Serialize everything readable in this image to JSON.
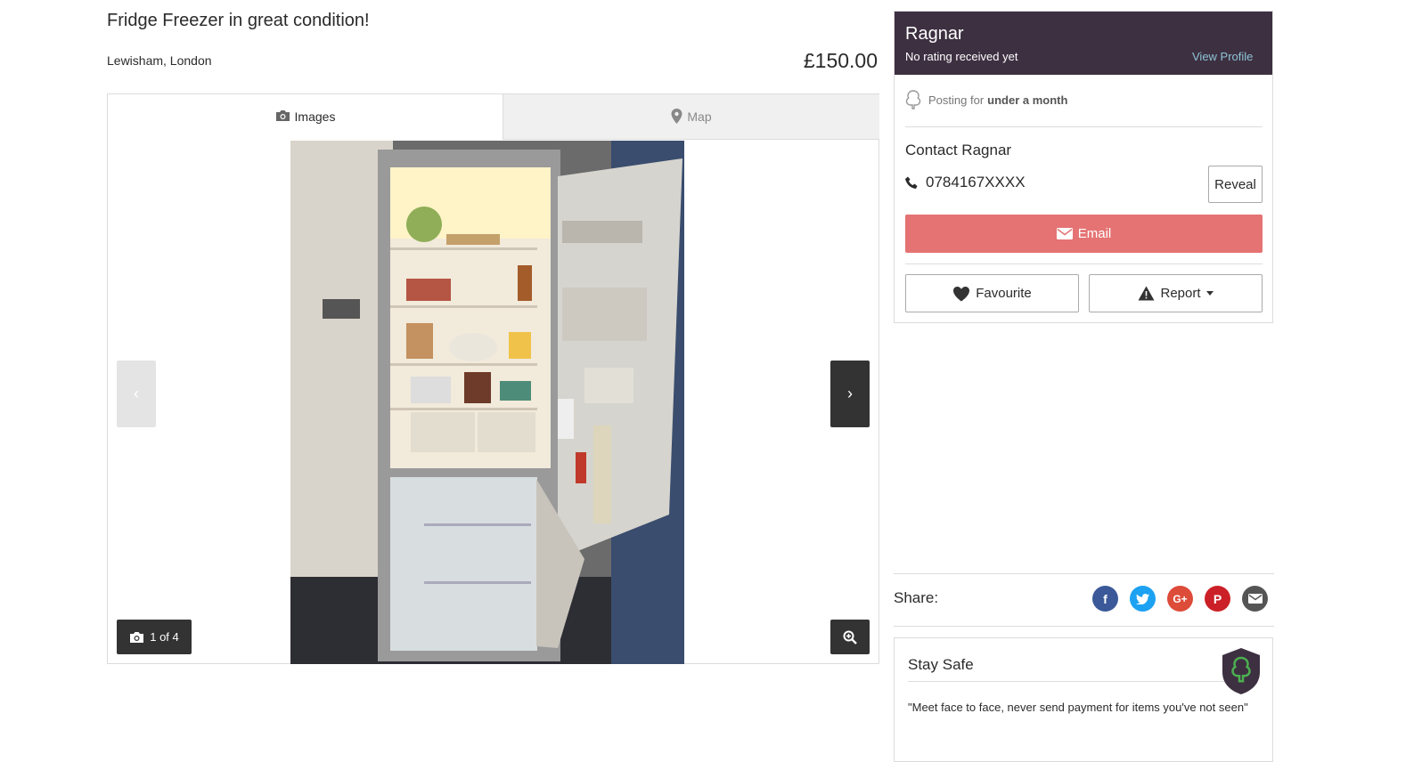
{
  "listing": {
    "title": "Fridge Freezer in great condition!",
    "location": "Lewisham, London",
    "price": "£150.00"
  },
  "gallery": {
    "tabs": [
      {
        "label": "Images",
        "icon": "camera-icon",
        "active": true
      },
      {
        "label": "Map",
        "icon": "map-pin-icon",
        "active": false
      }
    ],
    "prev_label": "‹",
    "next_label": "›",
    "counter": "1 of 4"
  },
  "seller": {
    "name": "Ragnar",
    "rating": "No rating received yet",
    "view_profile": "View Profile",
    "posting_prefix": "Posting for",
    "posting_duration": "under a month",
    "contact_title": "Contact Ragnar",
    "phone": "0784167XXXX",
    "reveal": "Reveal",
    "email": "Email",
    "favourite": "Favourite",
    "report": "Report"
  },
  "share": {
    "label": "Share:",
    "networks": [
      "facebook-icon",
      "twitter-icon",
      "google-plus-icon",
      "pinterest-icon",
      "email-share-icon"
    ]
  },
  "safety": {
    "title": "Stay Safe",
    "text": "\"Meet face to face, never send payment for items you've not seen\""
  },
  "colors": {
    "seller_header": "#3d3041",
    "email_button": "#e57373",
    "view_profile": "#8ec3d5",
    "facebook": "#3b5998",
    "twitter": "#1da1f2",
    "google_plus": "#dd4b39",
    "pinterest": "#cb2027",
    "email_share": "#555555"
  }
}
